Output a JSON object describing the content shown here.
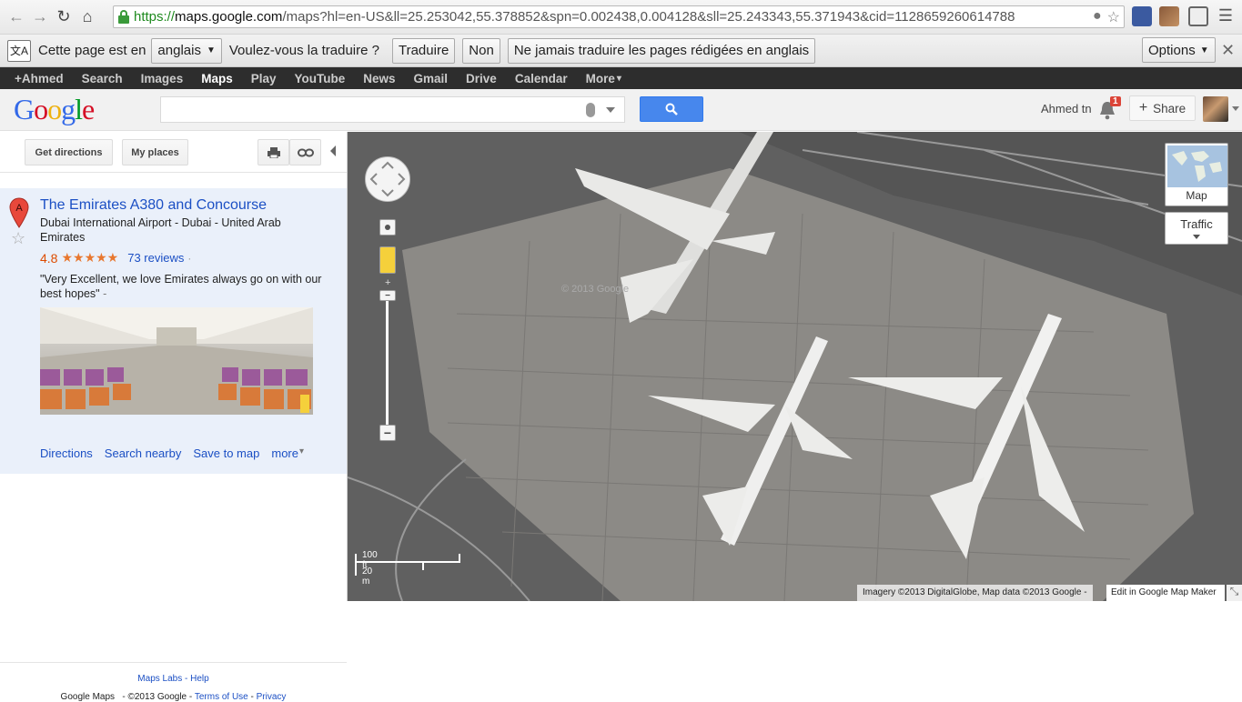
{
  "browser": {
    "url_secure": "https://",
    "url_domain": "maps.google.com",
    "url_path": "/maps?hl=en-US&ll=25.253042,55.378852&spn=0.002438,0.004128&sll=25.243343,55.371943&cid=1128659260614788"
  },
  "translate_bar": {
    "prefix": "Cette page est en",
    "language": "anglais",
    "question": "Voulez-vous la traduire ?",
    "translate_button": "Traduire",
    "no_button": "Non",
    "never_button": "Ne jamais traduire les pages rédigées en anglais",
    "options_button": "Options"
  },
  "google_bar": {
    "items": [
      "+Ahmed",
      "Search",
      "Images",
      "Maps",
      "Play",
      "YouTube",
      "News",
      "Gmail",
      "Drive",
      "Calendar",
      "More"
    ],
    "active": "Maps"
  },
  "header": {
    "logo": "Google",
    "search_value": "",
    "user_name": "Ahmed tn",
    "notification_count": "1",
    "share_label": "Share"
  },
  "panel": {
    "get_directions": "Get directions",
    "my_places": "My places",
    "place": {
      "marker_letter": "A",
      "title": "The Emirates A380 and Concourse",
      "address": "Dubai International Airport - Dubai - United Arab Emirates",
      "rating": "4.8",
      "stars": "★★★★★",
      "reviews": "73 reviews",
      "quote": "\"Very Excellent, we love Emirates always go on with our best hopes\"",
      "links": [
        "Directions",
        "Search nearby",
        "Save to map",
        "more"
      ]
    },
    "footer_labs": "Maps Labs",
    "footer_help": "Help",
    "footer_app": "Google Maps",
    "footer_copyright": "©2013 Google",
    "footer_terms": "Terms of Use",
    "footer_privacy": "Privacy"
  },
  "map": {
    "scale_ft": "100 ft",
    "scale_m": "20 m",
    "map_tile_label": "Map",
    "traffic_label": "Traffic",
    "attribution": "Imagery ©2013 DigitalGlobe, Map data ©2013 Google -",
    "edit_link": "Edit in Google Map Maker",
    "watermark": "© 2013 Google"
  },
  "colors": {
    "link": "#1b4fc4",
    "search_button": "#4787ed",
    "rating": "#dd4b00",
    "google_bar": "#2d2d2d"
  }
}
